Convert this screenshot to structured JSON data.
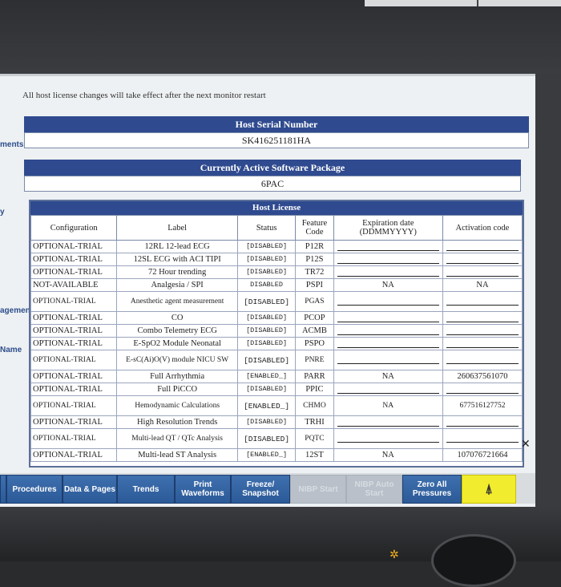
{
  "left_labels": [
    "ments",
    "y",
    "agement",
    "Name"
  ],
  "notice": "All host license changes will take effect after the next monitor restart",
  "host_serial": {
    "label": "Host Serial Number",
    "value": "SK416251181HA"
  },
  "software_package": {
    "label": "Currently Active Software Package",
    "value": "6PAC"
  },
  "host_license": {
    "title": "Host License",
    "columns": [
      "Configuration",
      "Label",
      "Status",
      "Feature Code",
      "Expiration date (DDMMYYYY)",
      "Activation code"
    ],
    "rows": [
      {
        "config": "OPTIONAL-TRIAL",
        "label": "12RL 12-lead ECG",
        "status": "[DISABLED]",
        "code": "P12R",
        "expiration": "",
        "activation": ""
      },
      {
        "config": "OPTIONAL-TRIAL",
        "label": "12SL ECG with ACI TIPI",
        "status": "[DISABLED]",
        "code": "P12S",
        "expiration": "",
        "activation": ""
      },
      {
        "config": "OPTIONAL-TRIAL",
        "label": "72 Hour trending",
        "status": "[DISABLED]",
        "code": "TR72",
        "expiration": "",
        "activation": ""
      },
      {
        "config": "NOT-AVAILABLE",
        "label": "Analgesia / SPI",
        "status": "DISABLED",
        "code": "PSPI",
        "expiration": "NA",
        "activation": "NA"
      },
      {
        "config": "OPTIONAL-TRIAL",
        "label": "Anesthetic agent measurement",
        "status": "[DISABLED]",
        "code": "PGAS",
        "expiration": "",
        "activation": ""
      },
      {
        "config": "OPTIONAL-TRIAL",
        "label": "CO",
        "status": "[DISABLED]",
        "code": "PCOP",
        "expiration": "",
        "activation": ""
      },
      {
        "config": "OPTIONAL-TRIAL",
        "label": "Combo Telemetry ECG",
        "status": "[DISABLED]",
        "code": "ACMB",
        "expiration": "",
        "activation": ""
      },
      {
        "config": "OPTIONAL-TRIAL",
        "label": "E-SpO2 Module Neonatal",
        "status": "[DISABLED]",
        "code": "PSPO",
        "expiration": "",
        "activation": ""
      },
      {
        "config": "OPTIONAL-TRIAL",
        "label": "E-sC(Ai)O(V) module NICU SW",
        "status": "[DISABLED]",
        "code": "PNRE",
        "expiration": "",
        "activation": ""
      },
      {
        "config": "OPTIONAL-TRIAL",
        "label": "Full Arrhythmia",
        "status": "[ENABLED_]",
        "code": "PARR",
        "expiration": "NA",
        "activation": "260637561070"
      },
      {
        "config": "OPTIONAL-TRIAL",
        "label": "Full PiCCO",
        "status": "[DISABLED]",
        "code": "PPIC",
        "expiration": "",
        "activation": ""
      },
      {
        "config": "OPTIONAL-TRIAL",
        "label": "Hemodynamic Calculations",
        "status": "[ENABLED_]",
        "code": "CHMO",
        "expiration": "NA",
        "activation": "677516127752"
      },
      {
        "config": "OPTIONAL-TRIAL",
        "label": "High Resolution Trends",
        "status": "[DISABLED]",
        "code": "TRHI",
        "expiration": "",
        "activation": ""
      },
      {
        "config": "OPTIONAL-TRIAL",
        "label": "Multi-lead QT / QTc Analysis",
        "status": "[DISABLED]",
        "code": "PQTC",
        "expiration": "",
        "activation": ""
      },
      {
        "config": "OPTIONAL-TRIAL",
        "label": "Multi-lead ST Analysis",
        "status": "[ENABLED_]",
        "code": "12ST",
        "expiration": "NA",
        "activation": "107076721664"
      }
    ]
  },
  "softkeys": [
    {
      "label": "",
      "state": "normal"
    },
    {
      "label": "Procedures",
      "state": "normal"
    },
    {
      "label": "Data & Pages",
      "state": "normal"
    },
    {
      "label": "Trends",
      "state": "normal"
    },
    {
      "label": "Print Waveforms",
      "state": "normal"
    },
    {
      "label": "Freeze/ Snapshot",
      "state": "normal"
    },
    {
      "label": "NIBP Start",
      "state": "disabled"
    },
    {
      "label": "NIBP Auto Start",
      "state": "disabled"
    },
    {
      "label": "Zero All Pressures",
      "state": "normal"
    },
    {
      "label": "",
      "state": "alarm"
    }
  ],
  "colors": {
    "header_blue": "#2f4a8f",
    "softkey_blue": "#2c5a98",
    "alarm_yellow": "#f2ec2e"
  },
  "icons": {
    "alarm_key": "alarm-silence-icon",
    "led": "power-led-icon",
    "scroll": "close-icon"
  }
}
